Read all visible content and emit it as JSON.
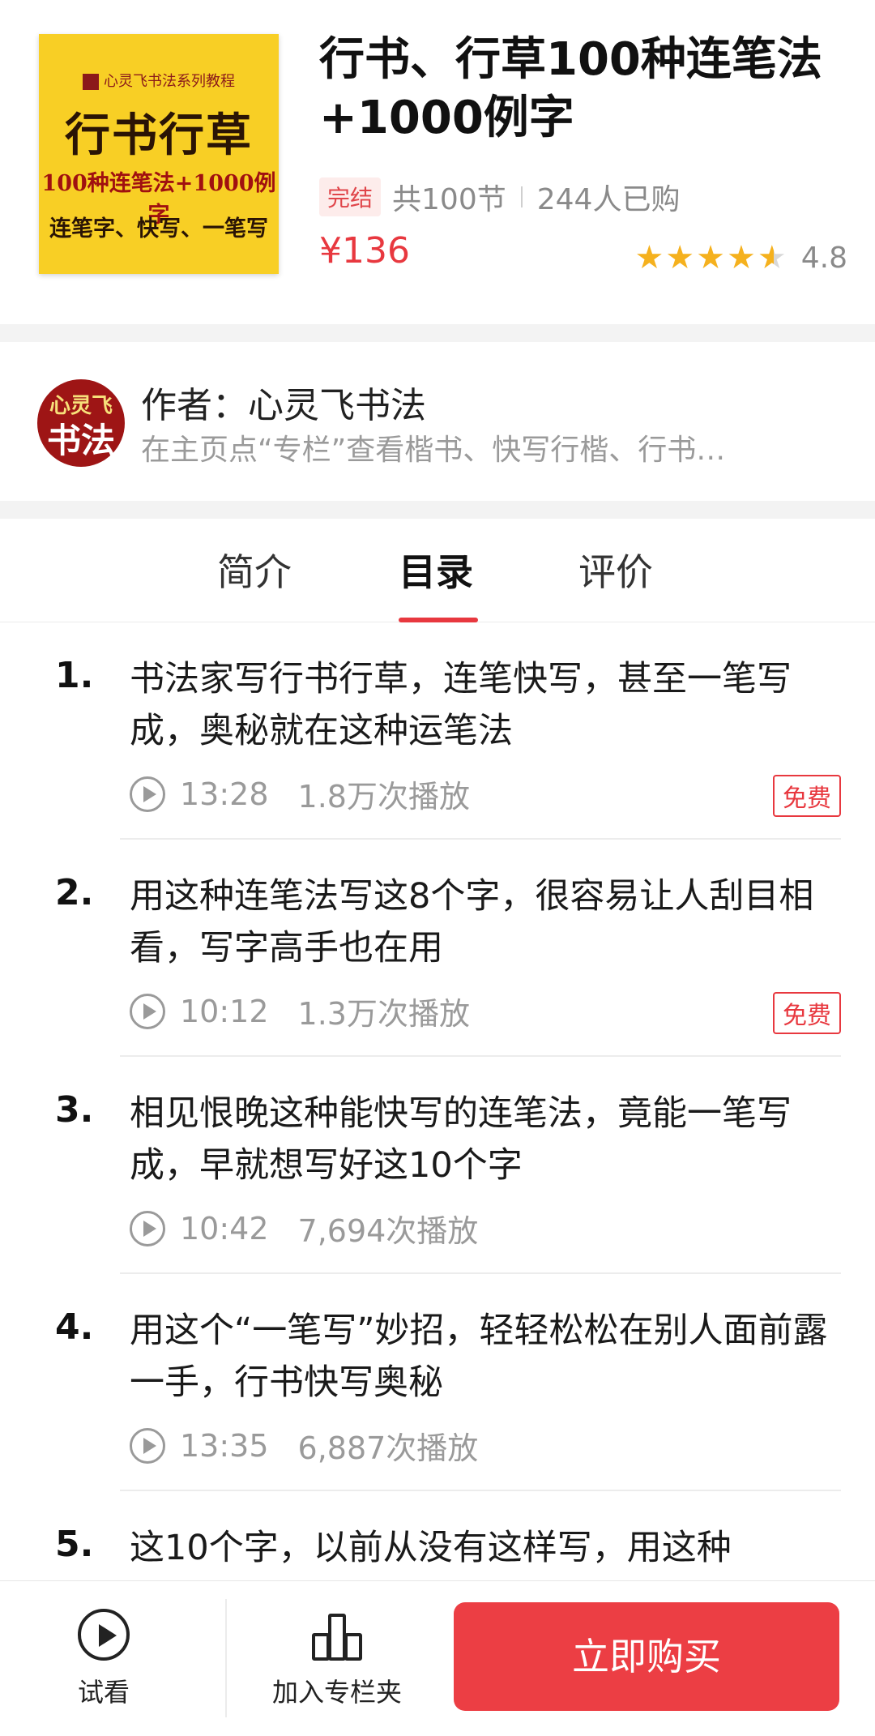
{
  "cover": {
    "series": "心灵飞书法系列教程",
    "title": "行书行草",
    "subtitle1": "100种连笔法+1000例字",
    "subtitle2": "连笔字、快写、一笔写"
  },
  "course": {
    "title": "行书、行草100种连笔法+1000例字",
    "status": "完结",
    "lesson_count": "共100节",
    "purchased": "244人已购",
    "price": "¥136",
    "rating": 4.8,
    "rating_text": "4.8"
  },
  "author": {
    "avatar_text_top": "心灵飞",
    "avatar_text_bottom": "书法",
    "name": "作者：心灵飞书法",
    "description": "在主页点“专栏”查看楷书、快写行楷、行书…"
  },
  "tabs": [
    {
      "label": "简介",
      "active": false
    },
    {
      "label": "目录",
      "active": true
    },
    {
      "label": "评价",
      "active": false
    }
  ],
  "lessons": [
    {
      "num": "1.",
      "title": "书法家写行书行草，连笔快写，甚至一笔写成，奥秘就在这种运笔法",
      "duration": "13:28",
      "plays": "1.8万次播放",
      "badge": "免费"
    },
    {
      "num": "2.",
      "title": "用这种连笔法写这8个字，很容易让人刮目相看，写字高手也在用",
      "duration": "10:12",
      "plays": "1.3万次播放",
      "badge": "免费"
    },
    {
      "num": "3.",
      "title": "相见恨晚这种能快写的连笔法，竟能一笔写成，早就想写好这10个字",
      "duration": "10:42",
      "plays": "7,694次播放",
      "badge": ""
    },
    {
      "num": "4.",
      "title": "用这个“一笔写”妙招，轻轻松松在别人面前露一手，行书快写奥秘",
      "duration": "13:35",
      "plays": "6,887次播放",
      "badge": ""
    },
    {
      "num": "5.",
      "title": "这10个字，以前从没有这样写，用这种",
      "duration": "",
      "plays": "",
      "badge": ""
    }
  ],
  "bottom_bar": {
    "trial_label": "试看",
    "collect_label": "加入专栏夹",
    "buy_label": "立即购买"
  },
  "colors": {
    "accent": "#e8383f",
    "star": "#f5b11e",
    "cover_bg": "#f8cf25"
  }
}
